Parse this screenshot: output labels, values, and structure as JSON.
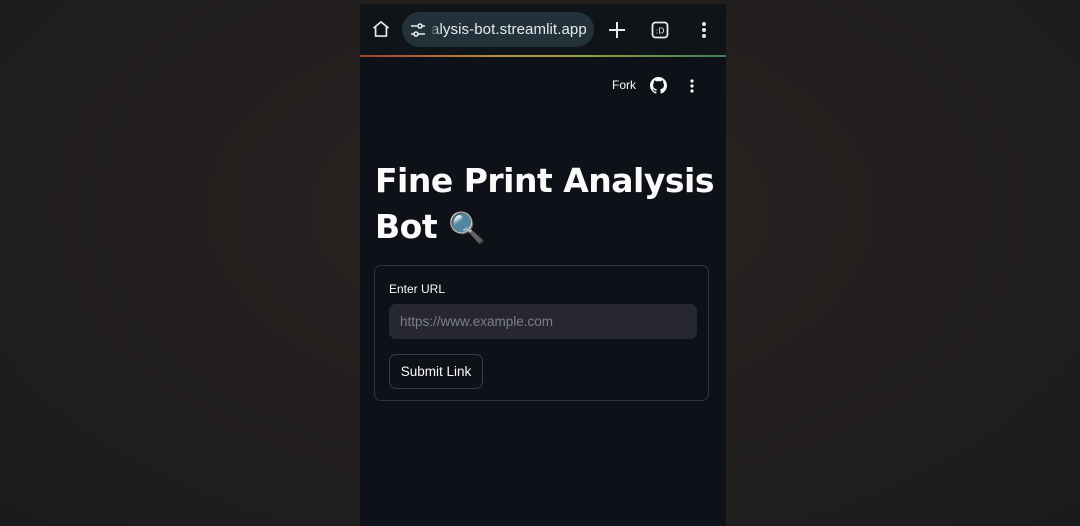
{
  "browser": {
    "url_display": "alysis-bot.streamlit.app",
    "tab_count": ":D",
    "icons": [
      "home-icon",
      "tune-icon",
      "plus-icon",
      "tabs-icon",
      "menu-icon"
    ]
  },
  "app": {
    "toolbar": {
      "fork_label": "Fork",
      "icons": [
        "github-icon",
        "more-vert-icon"
      ]
    },
    "title": "Fine Print Analysis Bot",
    "title_emoji": "🔍",
    "form": {
      "url_label": "Enter URL",
      "url_placeholder": "https://www.example.com",
      "url_value": "",
      "submit_label": "Submit Link"
    }
  },
  "colors": {
    "app_background": "#0e1117",
    "input_background": "#262730",
    "url_pill": "#23323a",
    "text": "#fafafa",
    "page_backdrop": "#231f1e"
  }
}
